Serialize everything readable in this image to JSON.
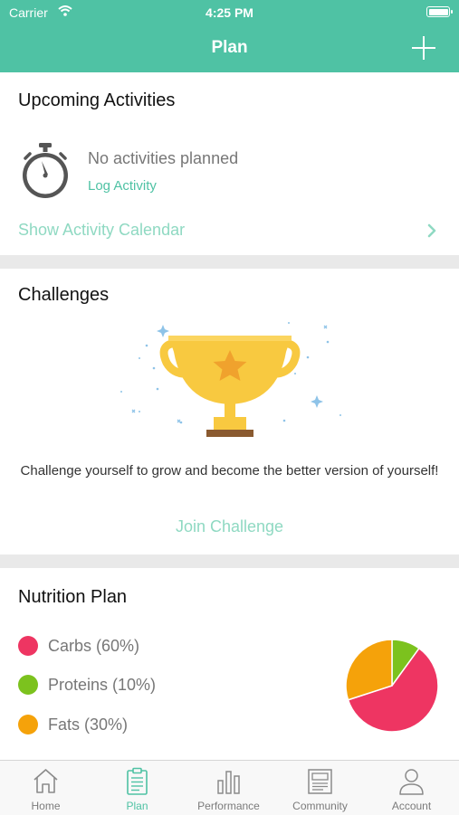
{
  "status_bar": {
    "carrier": "Carrier",
    "time": "4:25 PM",
    "battery_level": 1.0
  },
  "nav": {
    "title": "Plan",
    "add_icon": "plus-icon"
  },
  "upcoming": {
    "title": "Upcoming Activities",
    "icon": "stopwatch-icon",
    "empty_text": "No activities planned",
    "log_link": "Log Activity",
    "calendar_link": "Show Activity Calendar"
  },
  "challenges": {
    "title": "Challenges",
    "icon": "trophy-icon",
    "description": "Challenge yourself to grow and become the better version of yourself!",
    "join_link": "Join Challenge"
  },
  "nutrition": {
    "title": "Nutrition Plan",
    "items": [
      {
        "label": "Carbs (60%)",
        "color": "#ee3562",
        "percent": 60
      },
      {
        "label": "Proteins (10%)",
        "color": "#7cc21e",
        "percent": 10
      },
      {
        "label": "Fats (30%)",
        "color": "#f5a20a",
        "percent": 30
      }
    ]
  },
  "colors": {
    "accent": "#4fc2a4",
    "accent_light": "#8fd9c2",
    "trophy": "#f8c940"
  },
  "tabs": [
    {
      "label": "Home",
      "icon": "home-icon",
      "active": false
    },
    {
      "label": "Plan",
      "icon": "clipboard-icon",
      "active": true
    },
    {
      "label": "Performance",
      "icon": "bar-chart-icon",
      "active": false
    },
    {
      "label": "Community",
      "icon": "newspaper-icon",
      "active": false
    },
    {
      "label": "Account",
      "icon": "person-icon",
      "active": false
    }
  ]
}
